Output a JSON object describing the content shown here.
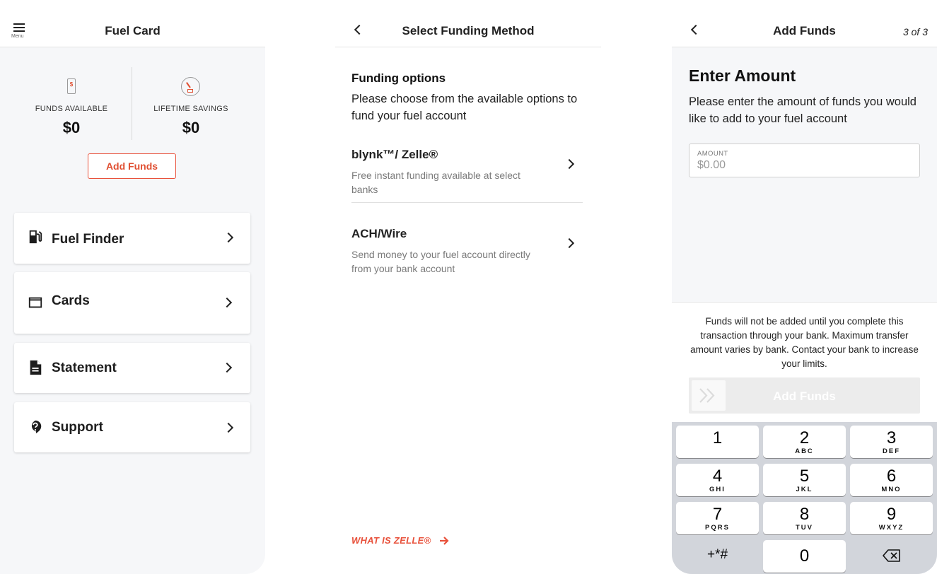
{
  "home": {
    "menu_label": "Menu",
    "title": "Fuel Card",
    "funds_available": {
      "label": "FUNDS AVAILABLE",
      "value": "$0",
      "icon": "phone-dollar-icon"
    },
    "lifetime_savings": {
      "label": "LIFETIME SAVINGS",
      "value": "$0",
      "icon": "speedometer-icon"
    },
    "add_funds_label": "Add Funds",
    "menu_items": [
      {
        "label": "Fuel Finder",
        "icon": "fuel-pump-icon"
      },
      {
        "label": "Cards",
        "icon": "credit-card-icon"
      },
      {
        "label": "Statement",
        "icon": "document-icon"
      },
      {
        "label": "Support",
        "icon": "help-icon"
      }
    ]
  },
  "funding": {
    "title": "Select Funding Method",
    "heading": "Funding options",
    "description": "Please choose from the available options to fund your fuel account",
    "options": [
      {
        "title": "blynk™/ Zelle®",
        "description": "Free instant funding available at select banks"
      },
      {
        "title": "ACH/Wire",
        "description": "Send money to your fuel account directly from your bank account"
      }
    ],
    "zelle_link": "WHAT IS ZELLE®"
  },
  "add_funds": {
    "title": "Add Funds",
    "step": "3 of 3",
    "heading": "Enter Amount",
    "description": "Please enter the amount of funds you would like to add to your fuel account",
    "amount_label": "AMOUNT",
    "amount_placeholder": "$0.00",
    "note": "Funds will not be added until you complete this transaction through your bank. Maximum transfer amount varies by bank. Contact your bank to increase your limits.",
    "submit_label": "Add Funds"
  },
  "keypad": {
    "keys": [
      {
        "n": "1",
        "s": ""
      },
      {
        "n": "2",
        "s": "ABC"
      },
      {
        "n": "3",
        "s": "DEF"
      },
      {
        "n": "4",
        "s": "GHI"
      },
      {
        "n": "5",
        "s": "JKL"
      },
      {
        "n": "6",
        "s": "MNO"
      },
      {
        "n": "7",
        "s": "PQRS"
      },
      {
        "n": "8",
        "s": "TUV"
      },
      {
        "n": "9",
        "s": "WXYZ"
      },
      {
        "n": "+*#",
        "s": ""
      },
      {
        "n": "0",
        "s": ""
      },
      {
        "n": "",
        "s": ""
      }
    ]
  },
  "colors": {
    "accent": "#e8513b",
    "page_bg": "#f6f7f9",
    "keypad_bg": "#d2d5db"
  }
}
